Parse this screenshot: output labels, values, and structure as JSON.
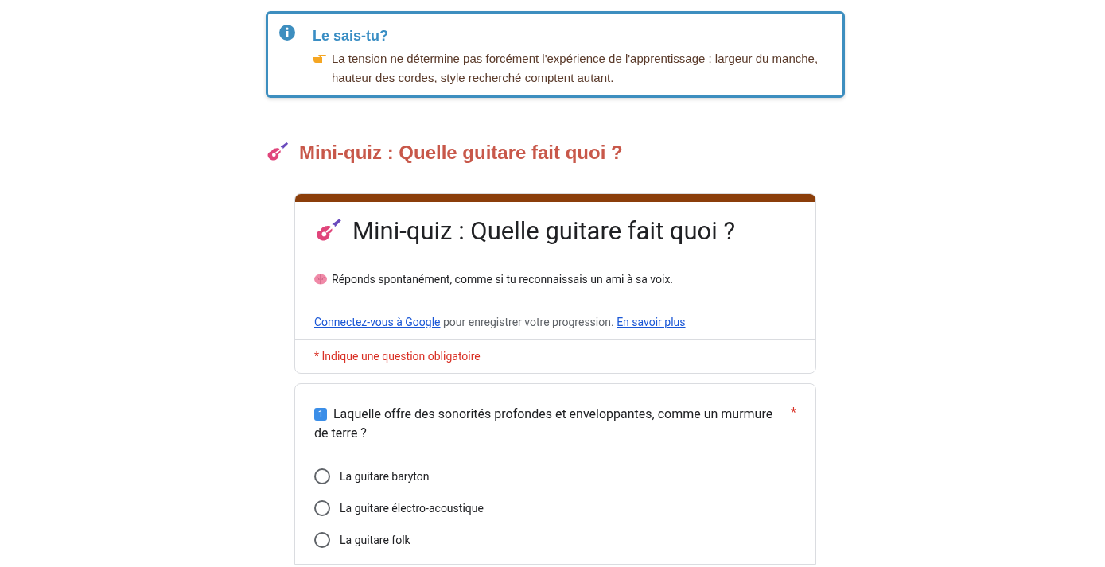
{
  "info_box": {
    "title": "Le sais-tu?",
    "text": "La tension ne détermine pas forcément l'expérience de l'apprentissage : largeur du manche, hauteur des cordes, style recherché comptent autant."
  },
  "section_heading": "Mini-quiz : Quelle guitare fait quoi ?",
  "form": {
    "title": "Mini-quiz : Quelle guitare fait quoi ?",
    "description": "Réponds spontanément, comme si tu reconnaissais un ami à sa voix.",
    "signin": {
      "link": "Connectez-vous à Google",
      "text": "pour enregistrer votre progression.",
      "more_link": "En savoir plus"
    },
    "required_note": "* Indique une question obligatoire"
  },
  "questions": [
    {
      "number": "1",
      "text": "Laquelle offre des sonorités profondes et enveloppantes, comme un murmure de terre ?",
      "required_mark": "*",
      "options": [
        {
          "label": "La guitare baryton",
          "selected": false
        },
        {
          "label": "La guitare électro-acoustique",
          "selected": false
        },
        {
          "label": "La guitare folk",
          "selected": false
        }
      ]
    }
  ]
}
